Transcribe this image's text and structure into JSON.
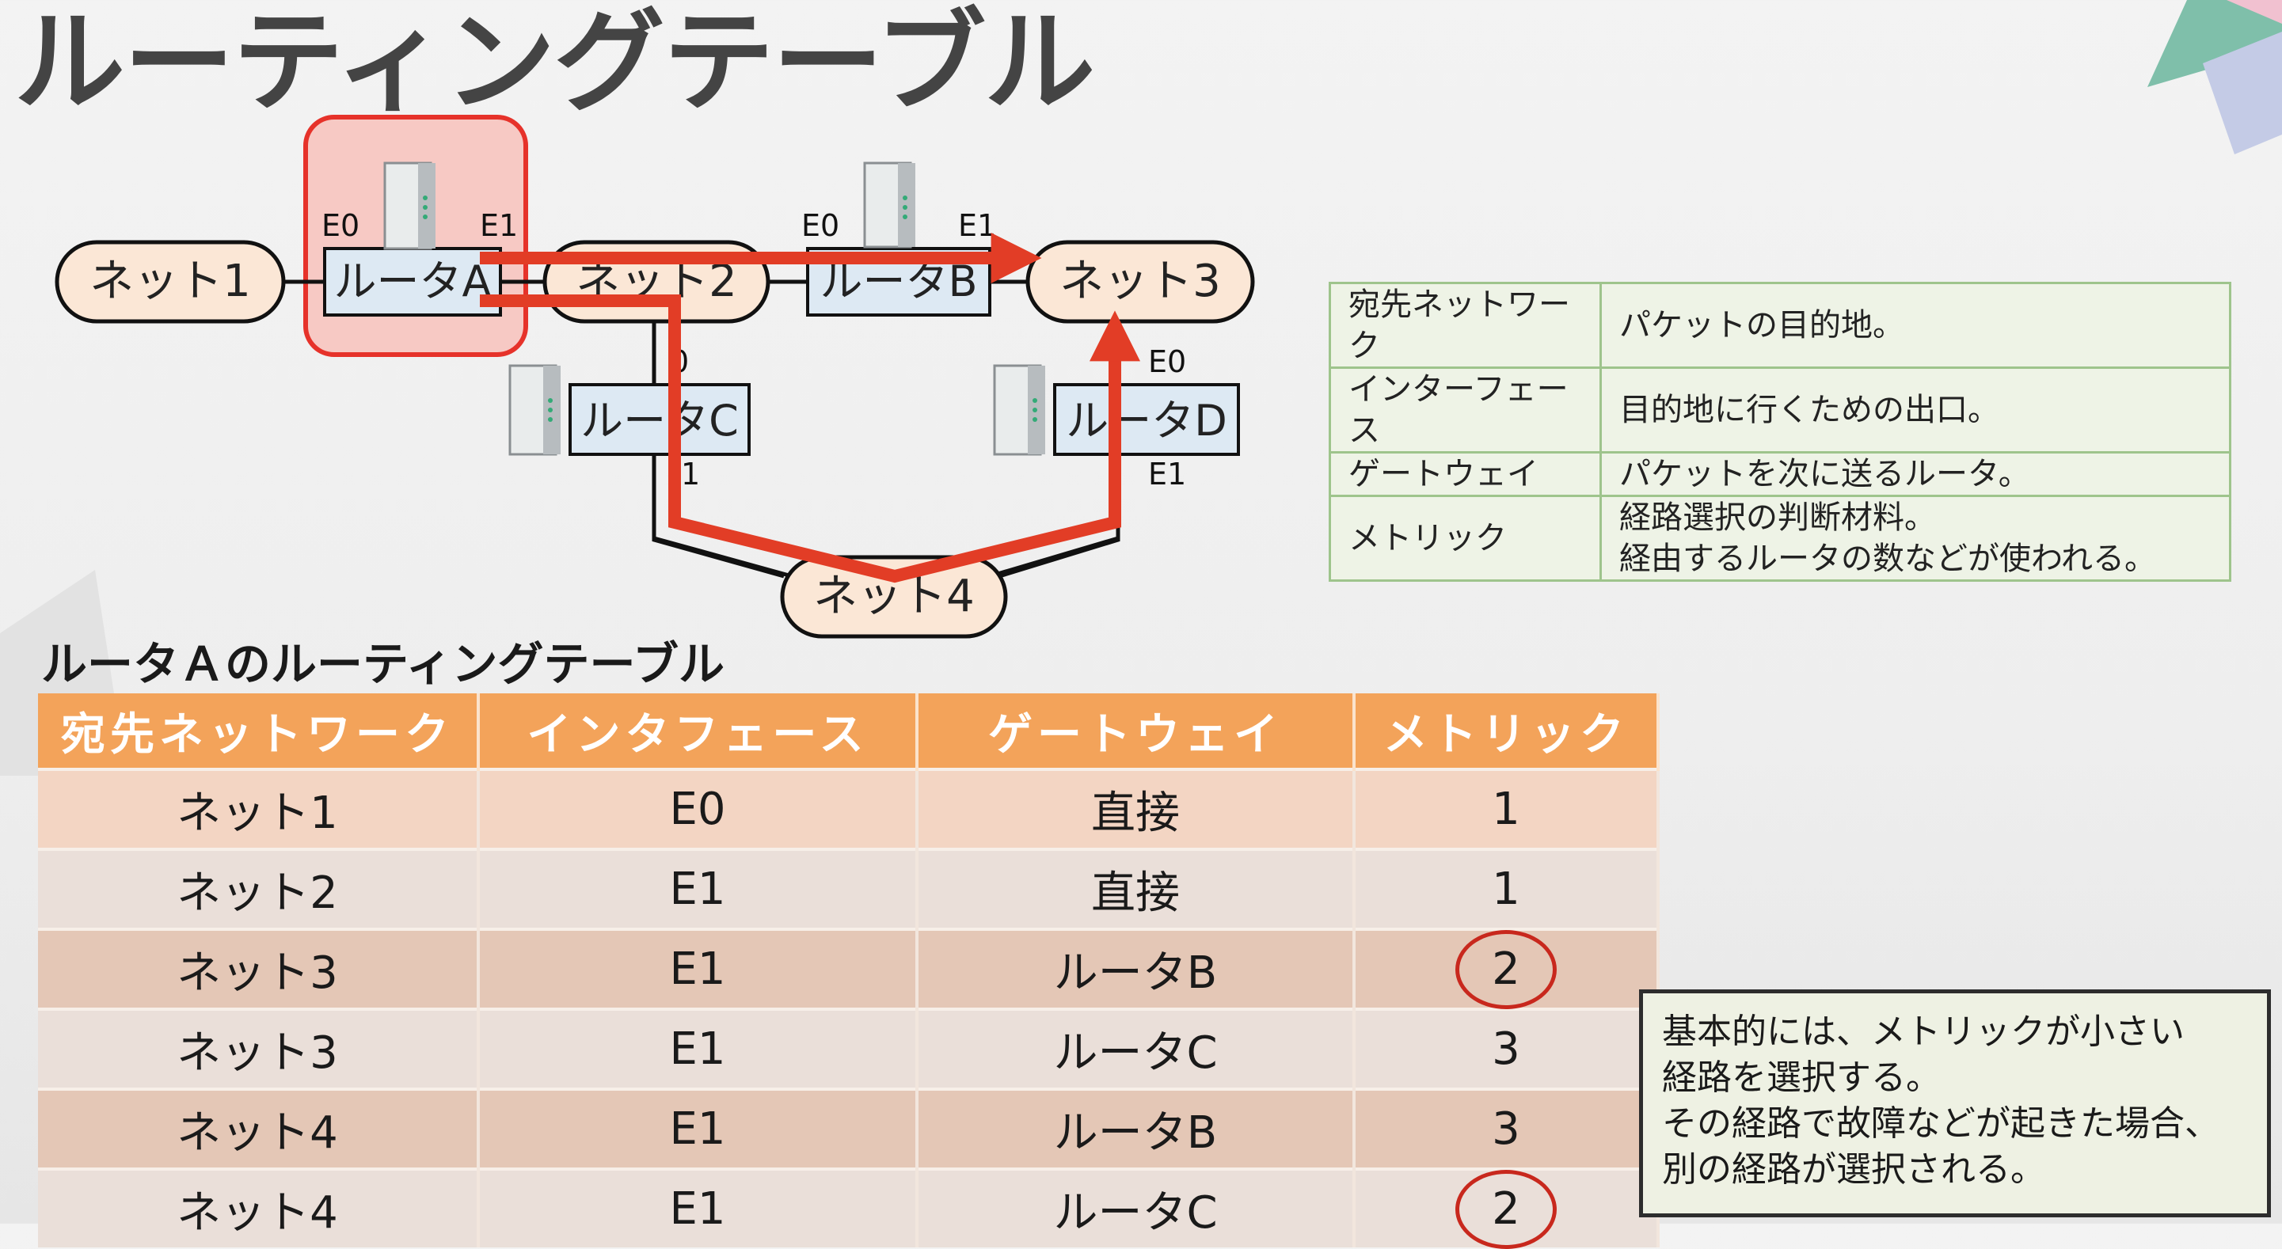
{
  "title": "ルーティングテーブル",
  "diagram": {
    "networks": {
      "net1": "ネット1",
      "net2": "ネット2",
      "net3": "ネット3",
      "net4": "ネット4"
    },
    "routers": {
      "a": "ルータA",
      "b": "ルータB",
      "c": "ルータC",
      "d": "ルータD"
    },
    "ports": {
      "a_e0": "E0",
      "a_e1": "E1",
      "b_e0": "E0",
      "b_e1": "E1",
      "c_e0": "0",
      "c_e1": "1",
      "d_e0": "E0",
      "d_e1": "E1"
    },
    "colors": {
      "route_arrow": "#e23d26",
      "network_fill": "#fbe7d6",
      "router_fill": "#dde9f3",
      "highlight_fill": "#f7c9c4",
      "highlight_border": "#e6322a"
    }
  },
  "glossary": [
    {
      "term": "宛先ネットワーク",
      "desc": [
        "パケットの目的地。"
      ]
    },
    {
      "term": "インターフェース",
      "desc": [
        "目的地に行くための出口。"
      ]
    },
    {
      "term": "ゲートウェイ",
      "desc": [
        "パケットを次に送るルータ。"
      ]
    },
    {
      "term": "メトリック",
      "desc": [
        "経路選択の判断材料。",
        "経由するルータの数などが使われる。"
      ]
    }
  ],
  "routing_table": {
    "heading": "ルータＡのルーティングテーブル",
    "columns": [
      "宛先ネットワーク",
      "インタフェース",
      "ゲートウェイ",
      "メトリック"
    ],
    "rows": [
      {
        "dest": "ネット1",
        "iface": "E0",
        "gateway": "直接",
        "metric": "1",
        "circled": false
      },
      {
        "dest": "ネット2",
        "iface": "E1",
        "gateway": "直接",
        "metric": "1",
        "circled": false
      },
      {
        "dest": "ネット3",
        "iface": "E1",
        "gateway": "ルータB",
        "metric": "2",
        "circled": true
      },
      {
        "dest": "ネット3",
        "iface": "E1",
        "gateway": "ルータC",
        "metric": "3",
        "circled": false
      },
      {
        "dest": "ネット4",
        "iface": "E1",
        "gateway": "ルータB",
        "metric": "3",
        "circled": false
      },
      {
        "dest": "ネット4",
        "iface": "E1",
        "gateway": "ルータC",
        "metric": "2",
        "circled": true
      }
    ]
  },
  "note": [
    "基本的には、メトリックが小さい",
    "経路を選択する。",
    "その経路で故障などが起きた場合、",
    "別の経路が選択される。"
  ]
}
